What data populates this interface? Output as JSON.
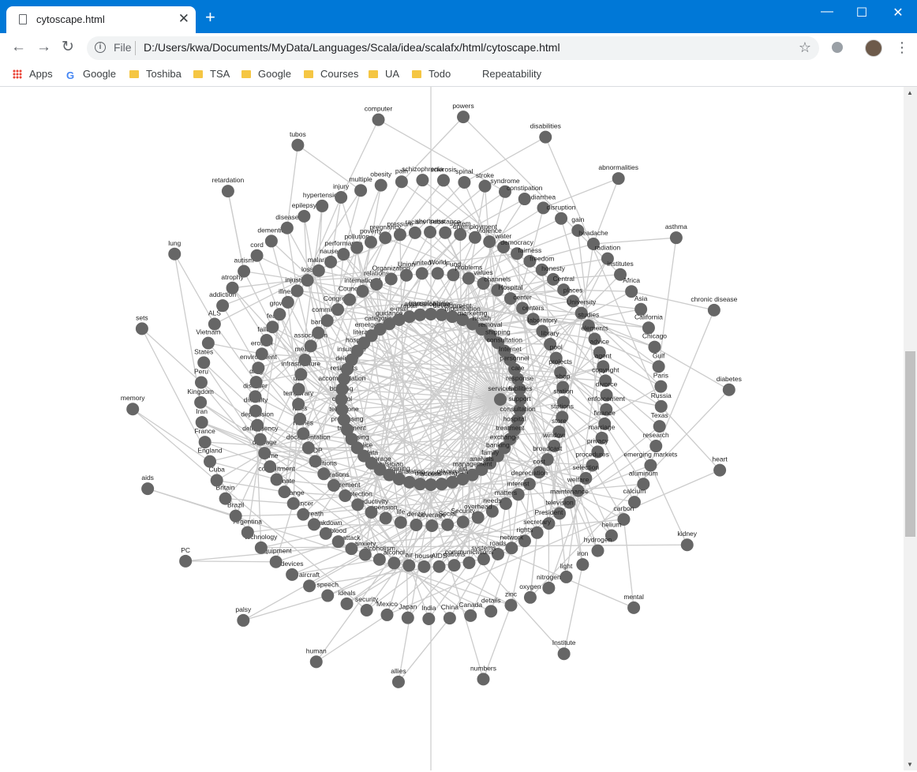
{
  "window": {
    "tab_title": "cytoscape.html",
    "new_tab_symbol": "+",
    "minimize_symbol": "—",
    "maximize_symbol": "☐",
    "close_symbol": "✕",
    "accent_color": "#0078d7"
  },
  "toolbar": {
    "scheme_label": "File",
    "url": "D:/Users/kwa/Documents/MyData/Languages/Scala/idea/scalafx/html/cytoscape.html",
    "icons": [
      "back-icon",
      "forward-icon",
      "reload-icon",
      "info-icon",
      "star-icon",
      "extension-icon",
      "avatar",
      "menu-icon"
    ]
  },
  "bookmarks": {
    "items": [
      "Apps",
      "Google",
      "Toshiba",
      "TSA",
      "Google",
      "Courses",
      "UA",
      "Todo",
      "Repeatability"
    ]
  },
  "graph": {
    "center": "services",
    "node_color": "#666666",
    "edge_color": "#cccccc",
    "rings": [
      [
        "transplantation",
        "home",
        "development",
        "modification",
        "marketing",
        "health",
        "removal",
        "shipping",
        "consultation",
        "Internet",
        "personnel",
        "care",
        "response",
        "facilities",
        "support",
        "consultation",
        "hospital",
        "treatment",
        "exchange",
        "banking",
        "family",
        "analysis",
        "management",
        "aid",
        "placement",
        "monitoring",
        "access",
        "use",
        "translation",
        "training",
        "physician",
        "storage",
        "data",
        "police",
        "housing",
        "treatment",
        "processing",
        "telephone",
        "control",
        "booking",
        "accommodation",
        "residents",
        "delivery",
        "insurance",
        "hospital",
        "literacy",
        "emergency",
        "categories",
        "guidance",
        "e-mail",
        "repair",
        "assistance"
      ],
      [
        "Fund",
        "problems",
        "values",
        "channels",
        "Hospital",
        "center",
        "centers",
        "laboratory",
        "library",
        "pool",
        "projects",
        "shop",
        "station",
        "stations",
        "store",
        "window",
        "broadcast",
        "cost",
        "depreciation",
        "interest",
        "matters",
        "needs",
        "overhead",
        "Security",
        "Social",
        "coverage",
        "dental",
        "life",
        "pension",
        "productivity",
        "protection",
        "retirement",
        "operations",
        "positions",
        "GDP",
        "documentation",
        "names",
        "rates",
        "temporary",
        "use",
        "infrastructure",
        "means",
        "association",
        "bank",
        "committee",
        "Congress",
        "Council",
        "international",
        "relations",
        "Organization",
        "Union",
        "united",
        "World"
      ],
      [
        "violence",
        "water",
        "democracy",
        "fairness",
        "freedom",
        "honesty",
        "Central",
        "places",
        "University",
        "studies",
        "elements",
        "advice",
        "agent",
        "copyright",
        "divorce",
        "enforcement",
        "finance",
        "marriage",
        "privacy",
        "procedures",
        "selection",
        "welfare",
        "maintenance",
        "television",
        "President",
        "secretary",
        "rights",
        "network",
        "roads",
        "systems",
        "communications",
        "nations",
        "AIDS",
        "house",
        "air",
        "alcohol",
        "alcoholism",
        "anxiety",
        "attack",
        "blood",
        "breakdown",
        "breath",
        "cancer",
        "change",
        "climate",
        "commitment",
        "crime",
        "damage",
        "delinquency",
        "depression",
        "difficulty",
        "disorder",
        "drug",
        "environment",
        "erosion",
        "failure",
        "fear",
        "growth",
        "illness",
        "injustice",
        "loss",
        "malaria",
        "nausea",
        "performance",
        "pollution",
        "poverty",
        "pregnancy",
        "pressure",
        "racism",
        "shortness",
        "substance",
        "system",
        "unemployment"
      ],
      [
        "diarrhea",
        "disruption",
        "gain",
        "headache",
        "radiation",
        "institutes",
        "Africa",
        "Asia",
        "California",
        "Chicago",
        "Gulf",
        "Paris",
        "Russia",
        "Texas",
        "research",
        "emerging markets",
        "aluminum",
        "calcium",
        "carbon",
        "helium",
        "hydrogen",
        "iron",
        "light",
        "nitrogen",
        "oxygen",
        "zinc",
        "details",
        "Canada",
        "China",
        "India",
        "Japan",
        "Mexico",
        "security",
        "ideals",
        "speech",
        "aircraft",
        "devices",
        "equipment",
        "technology",
        "Argentina",
        "Brazil",
        "Britain",
        "Cuba",
        "England",
        "France",
        "Iran",
        "Kingdom",
        "Peru",
        "States",
        "Vietnam",
        "ALS",
        "addiction",
        "atrophy",
        "autism",
        "cord",
        "dementia",
        "disease",
        "epilepsy",
        "hypertension",
        "injury",
        "multiple",
        "obesity",
        "pain",
        "schizophrenia",
        "sclerosis",
        "spinal",
        "stroke",
        "syndrome",
        "constipation"
      ],
      [
        "abnormalities",
        "asthma",
        "chronic disease",
        "diabetes",
        "heart",
        "kidney",
        "mental",
        "Institute",
        "numbers",
        "allies",
        "human",
        "palsy",
        "PC",
        "aids",
        "memory",
        "sets",
        "lung",
        "retardation",
        "tubos",
        "computer",
        "powers",
        "disabilities"
      ]
    ]
  }
}
